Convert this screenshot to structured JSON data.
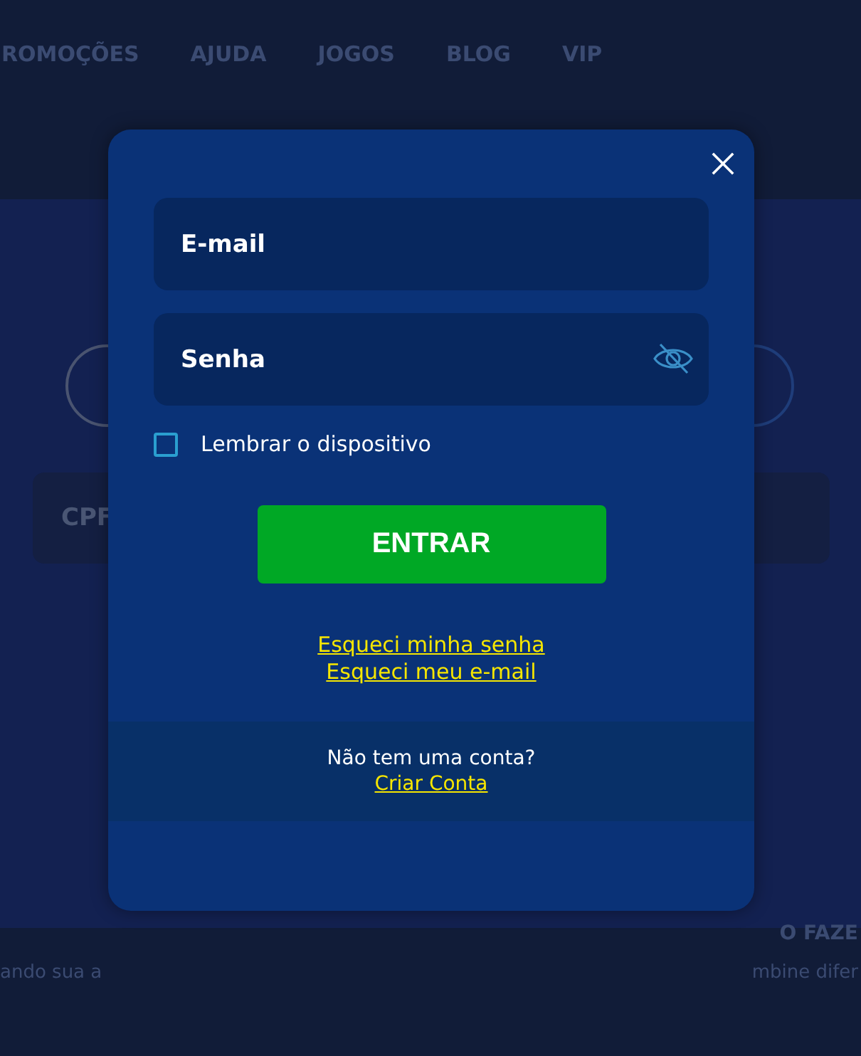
{
  "background": {
    "nav": [
      "ROMOÇÕES",
      "AJUDA",
      "JOGOS",
      "BLOG",
      "VIP"
    ],
    "field_label": "CPF",
    "heading_fragment": "O FAZE",
    "text_left": "ando sua a",
    "text_right": "mbine difer"
  },
  "login_dialog": {
    "email": {
      "placeholder": "E-mail"
    },
    "password": {
      "placeholder": "Senha"
    },
    "remember": {
      "label": "Lembrar o dispositivo",
      "checked": false
    },
    "submit": "ENTRAR",
    "links": [
      "Esqueci minha senha",
      "Esqueci meu e-mail"
    ],
    "footer": {
      "text": "Não tem uma conta?",
      "link": "Criar Conta"
    }
  }
}
